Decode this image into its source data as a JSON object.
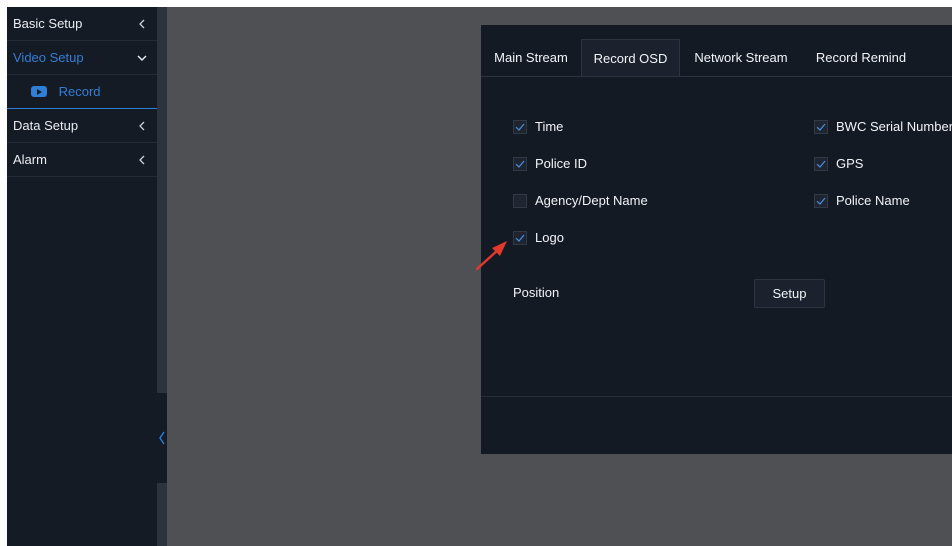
{
  "sidebar": {
    "items": [
      {
        "label": "Basic Setup",
        "chevron": "chevron-left-icon"
      },
      {
        "label": "Video Setup",
        "chevron": "chevron-down-icon",
        "active": true
      },
      {
        "label": "Data Setup",
        "chevron": "chevron-left-icon"
      },
      {
        "label": "Alarm",
        "chevron": "chevron-left-icon"
      }
    ],
    "sub_item": {
      "label": "Record",
      "icon": "record-icon"
    },
    "collapse_icon": "chevron-left-icon"
  },
  "tabs": [
    {
      "label": "Main Stream"
    },
    {
      "label": "Record OSD",
      "active": true
    },
    {
      "label": "Network Stream"
    },
    {
      "label": "Record Remind"
    }
  ],
  "osd": {
    "options": [
      {
        "label": "Time",
        "checked": true
      },
      {
        "label": "BWC Serial Number",
        "checked": true
      },
      {
        "label": "Police ID",
        "checked": true
      },
      {
        "label": "GPS",
        "checked": true
      },
      {
        "label": "Agency/Dept Name",
        "checked": false
      },
      {
        "label": "Police Name",
        "checked": true
      },
      {
        "label": "Logo",
        "checked": true
      }
    ],
    "position_label": "Position",
    "setup_button": "Setup"
  },
  "colors": {
    "accent": "#2f7fd6",
    "sidebar_bg": "#151b25",
    "panel_bg": "#141a24",
    "workspace_bg": "#4e5054",
    "annotation_arrow": "#e5382c"
  }
}
